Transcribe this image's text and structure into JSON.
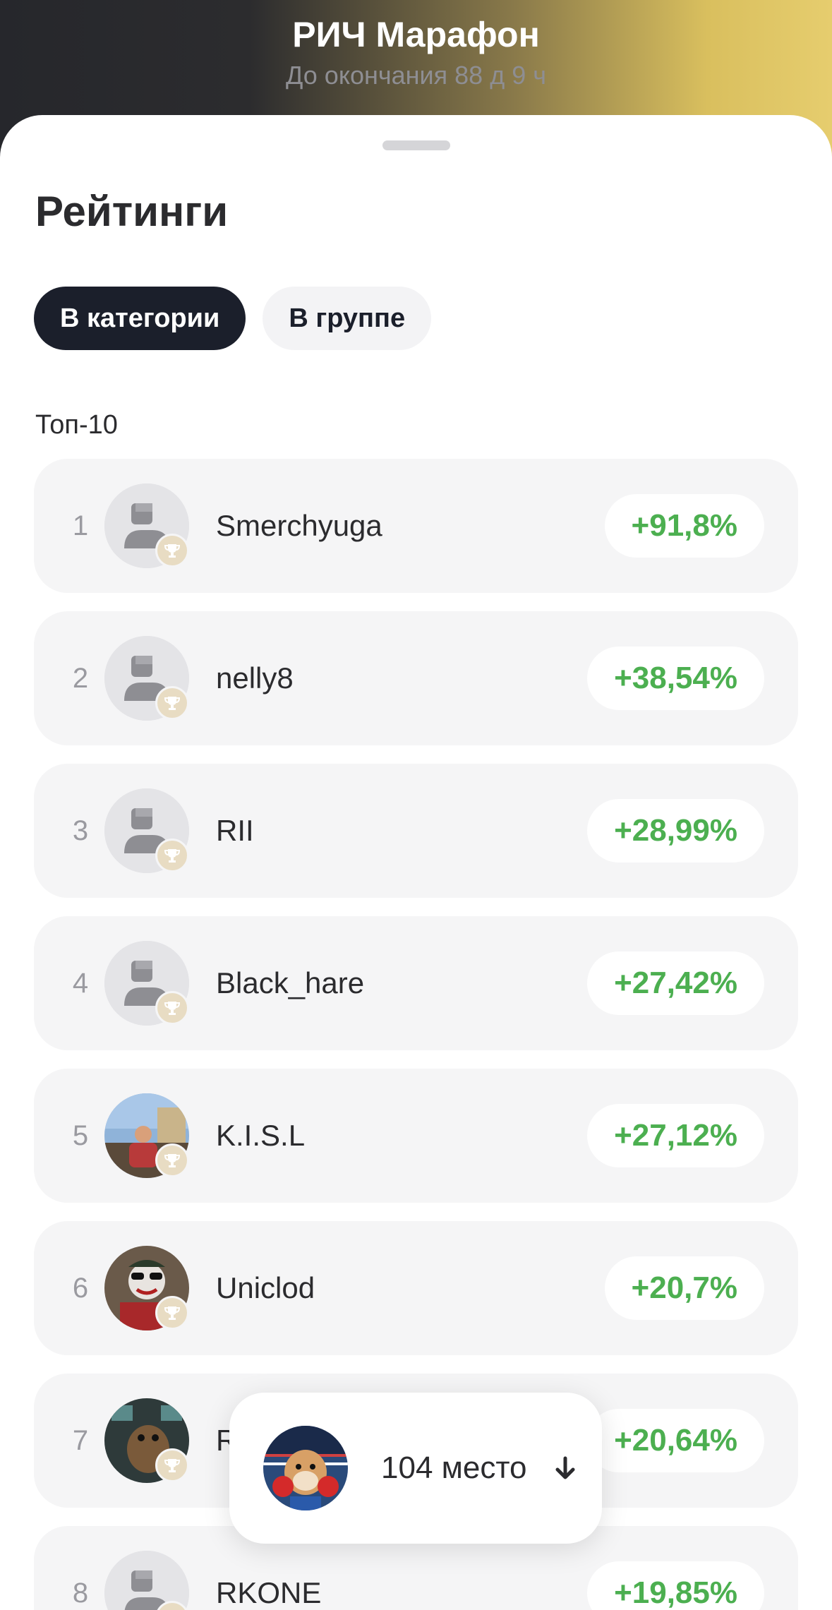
{
  "header": {
    "title": "РИЧ Марафон",
    "subtitle": "До окончания 88 д 9 ч"
  },
  "sheet": {
    "title": "Рейтинги",
    "tabs": [
      {
        "label": "В категории",
        "active": true
      },
      {
        "label": "В группе",
        "active": false
      }
    ],
    "section_label": "Топ-10"
  },
  "leaderboard": [
    {
      "rank": "1",
      "name": "Smerchyuga",
      "change": "+91,8%",
      "avatar": "default-avatar-icon"
    },
    {
      "rank": "2",
      "name": "nelly8",
      "change": "+38,54%",
      "avatar": "default-avatar-icon"
    },
    {
      "rank": "3",
      "name": "RII",
      "change": "+28,99%",
      "avatar": "default-avatar-icon"
    },
    {
      "rank": "4",
      "name": "Black_hare",
      "change": "+27,42%",
      "avatar": "default-avatar-icon"
    },
    {
      "rank": "5",
      "name": "K.I.S.L",
      "change": "+27,12%",
      "avatar": "photo-avatar"
    },
    {
      "rank": "6",
      "name": "Uniclod",
      "change": "+20,7%",
      "avatar": "photo-avatar"
    },
    {
      "rank": "7",
      "name": "R",
      "change": "+20,64%",
      "avatar": "photo-avatar"
    },
    {
      "rank": "8",
      "name": "RKONE",
      "change": "+19,85%",
      "avatar": "default-avatar-icon"
    }
  ],
  "my_position": {
    "label": "104 место",
    "icon": "arrow-down-icon"
  },
  "colors": {
    "positive": "#4caf50",
    "tab_active_bg": "#1b1f2b",
    "row_bg": "#f5f5f6"
  }
}
